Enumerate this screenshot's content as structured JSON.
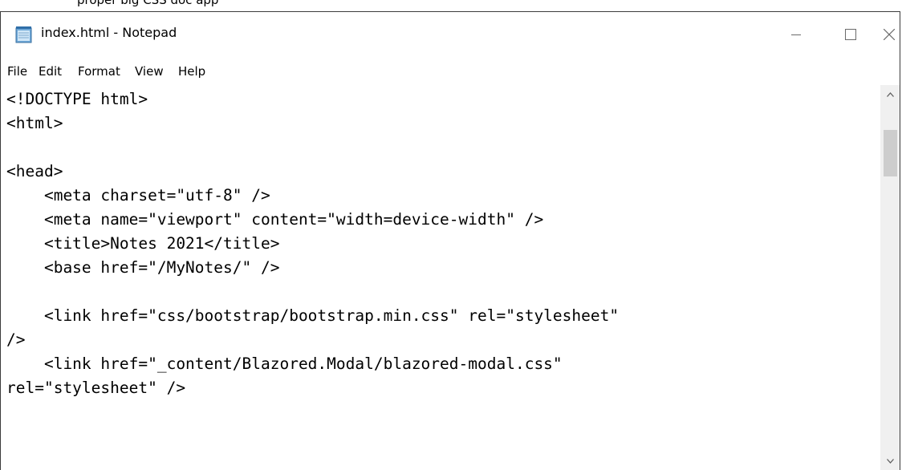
{
  "caption": "proper big CSS doc app",
  "window": {
    "title": "index.html - Notepad",
    "app_icon": "notepad-icon"
  },
  "controls": {
    "minimize_icon": "minimize-icon",
    "maximize_icon": "maximize-icon",
    "close_icon": "close-icon"
  },
  "menu": [
    "File",
    "Edit",
    "Format",
    "View",
    "Help"
  ],
  "lines": [
    "<!DOCTYPE html>",
    "<html>",
    "",
    "<head>",
    "    <meta charset=\"utf-8\" />",
    "    <meta name=\"viewport\" content=\"width=device-width\" />",
    "    <title>Notes 2021</title>",
    "    <base href=\"/MyNotes/\" />",
    "",
    "    <link href=\"css/bootstrap/bootstrap.min.css\" rel=\"stylesheet\"",
    "/>",
    "    <link href=\"_content/Blazored.Modal/blazored-modal.css\"",
    "rel=\"stylesheet\" />"
  ],
  "scrollbar": {
    "up_icon": "scroll-up-arrow-icon",
    "down_icon": "scroll-down-arrow-icon"
  }
}
